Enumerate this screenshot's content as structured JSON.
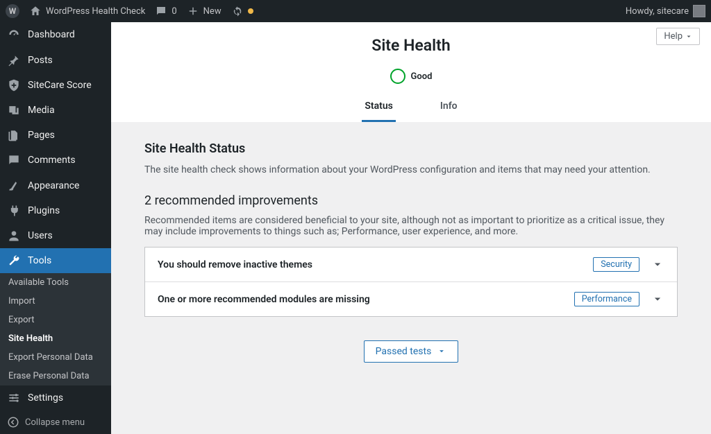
{
  "adminbar": {
    "site_name": "WordPress Health Check",
    "comments": "0",
    "new_label": "New",
    "howdy": "Howdy, sitecare"
  },
  "sidebar": {
    "items": [
      {
        "label": "Dashboard"
      },
      {
        "label": "Posts"
      },
      {
        "label": "SiteCare Score"
      },
      {
        "label": "Media"
      },
      {
        "label": "Pages"
      },
      {
        "label": "Comments"
      },
      {
        "label": "Appearance"
      },
      {
        "label": "Plugins"
      },
      {
        "label": "Users"
      },
      {
        "label": "Tools"
      },
      {
        "label": "Settings"
      }
    ],
    "submenu": [
      "Available Tools",
      "Import",
      "Export",
      "Site Health",
      "Export Personal Data",
      "Erase Personal Data"
    ],
    "collapse": "Collapse menu"
  },
  "header": {
    "help": "Help",
    "title": "Site Health",
    "progress_label": "Good",
    "tabs": {
      "status": "Status",
      "info": "Info"
    }
  },
  "status": {
    "heading": "Site Health Status",
    "intro": "The site health check shows information about your WordPress configuration and items that may need your attention.",
    "rec_heading": "2 recommended improvements",
    "rec_intro": "Recommended items are considered beneficial to your site, although not as important to prioritize as a critical issue, they may include improvements to things such as; Performance, user experience, and more.",
    "items": [
      {
        "title": "You should remove inactive themes",
        "badge": "Security"
      },
      {
        "title": "One or more recommended modules are missing",
        "badge": "Performance"
      }
    ],
    "passed_button": "Passed tests"
  }
}
